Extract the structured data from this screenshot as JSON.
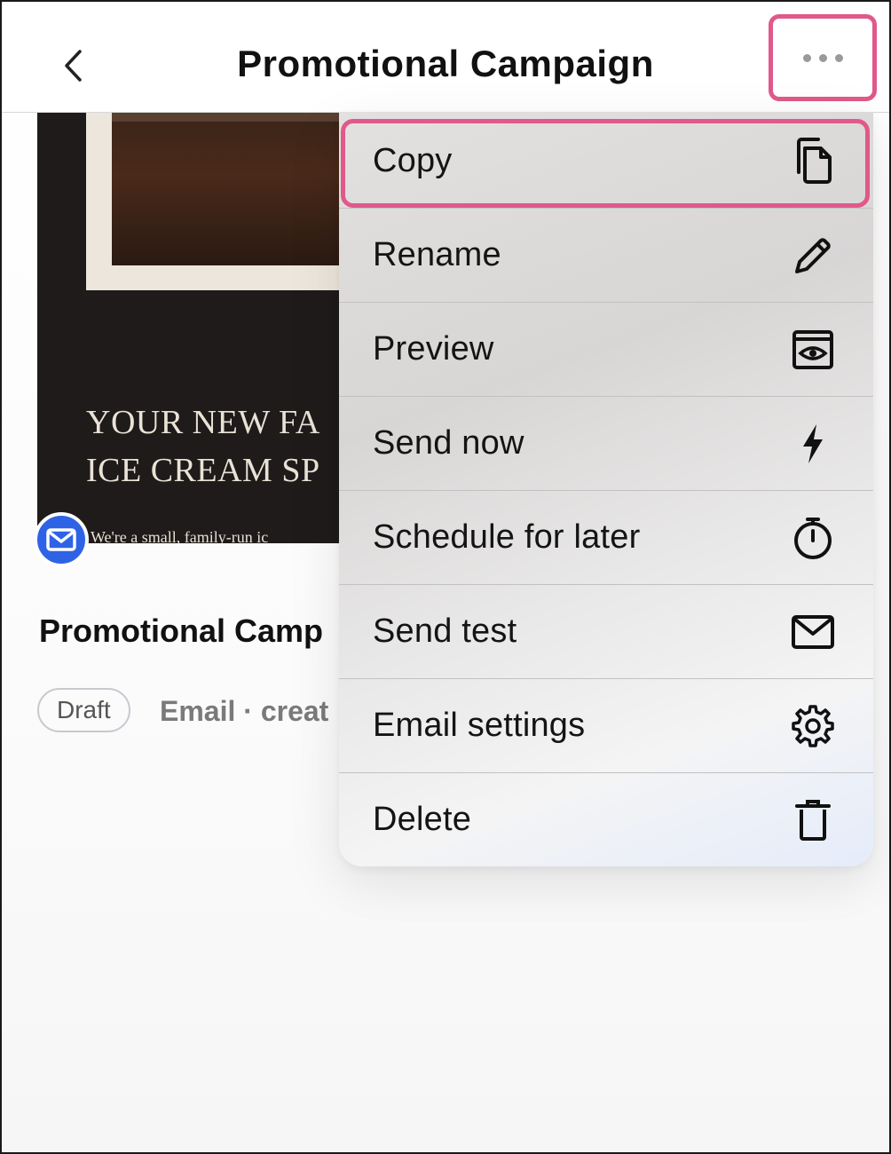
{
  "header": {
    "title": "Promotional Campaign",
    "back_icon": "chevron-left-icon",
    "more_icon": "ellipsis-icon"
  },
  "campaign": {
    "thumbnail_headline_line1": "YOUR NEW FA",
    "thumbnail_headline_line2": "ICE CREAM SP",
    "thumbnail_body": "We're a small, family-run ic",
    "name": "Promotional Camp",
    "status": "Draft",
    "meta": "Email · creat"
  },
  "menu": {
    "items": [
      {
        "label": "Copy",
        "icon": "copy-icon"
      },
      {
        "label": "Rename",
        "icon": "pencil-icon"
      },
      {
        "label": "Preview",
        "icon": "eye-icon"
      },
      {
        "label": "Send now",
        "icon": "lightning-icon"
      },
      {
        "label": "Schedule for later",
        "icon": "stopwatch-icon"
      },
      {
        "label": "Send test",
        "icon": "envelope-icon"
      },
      {
        "label": "Email settings",
        "icon": "gear-icon"
      },
      {
        "label": "Delete",
        "icon": "trash-icon"
      }
    ]
  },
  "colors": {
    "highlight": "#e0598a",
    "email_badge": "#2f63e6"
  }
}
